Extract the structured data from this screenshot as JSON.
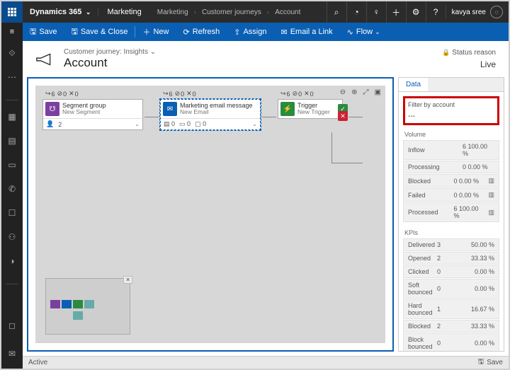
{
  "topbar": {
    "brand": "Dynamics 365",
    "module": "Marketing",
    "breadcrumbs": [
      "Marketing",
      "Customer journeys",
      "Account"
    ],
    "user": "kavya sree"
  },
  "commands": {
    "save": "Save",
    "save_close": "Save & Close",
    "new": "New",
    "refresh": "Refresh",
    "assign": "Assign",
    "email": "Email a Link",
    "flow": "Flow"
  },
  "header": {
    "sub": "Customer journey: Insights",
    "title": "Account",
    "status_label": "Status reason",
    "status_value": "Live"
  },
  "tiles": [
    {
      "stat_a": "6",
      "stat_b": "0",
      "stat_c": "0",
      "title": "Segment group",
      "sub": "New Segment",
      "bot": "2"
    },
    {
      "stat_a": "6",
      "stat_b": "0",
      "stat_c": "0",
      "title": "Marketing email message",
      "sub": "New Email",
      "b1": "0",
      "b2": "0",
      "b3": "0"
    },
    {
      "stat_a": "6",
      "stat_b": "0",
      "stat_c": "0",
      "title": "Trigger",
      "sub": "New Trigger"
    }
  ],
  "side": {
    "tab": "Data",
    "filter_label": "Filter by account",
    "filter_value": "---",
    "volume_h": "Volume",
    "kpi_h": "KPIs",
    "volume": [
      {
        "k": "Inflow",
        "v": "6",
        "p": "100.00 %"
      },
      {
        "k": "Processing",
        "v": "0",
        "p": "0.00 %"
      },
      {
        "k": "Blocked",
        "v": "0",
        "p": "0.00 %"
      },
      {
        "k": "Failed",
        "v": "0",
        "p": "0.00 %"
      },
      {
        "k": "Processed",
        "v": "6",
        "p": "100.00 %"
      }
    ],
    "kpis": [
      {
        "k": "Delivered",
        "v": "3",
        "p": "50.00 %"
      },
      {
        "k": "Opened",
        "v": "2",
        "p": "33.33 %"
      },
      {
        "k": "Clicked",
        "v": "0",
        "p": "0.00 %"
      },
      {
        "k": "Soft bounced",
        "v": "0",
        "p": "0.00 %"
      },
      {
        "k": "Hard bounced",
        "v": "1",
        "p": "16.67 %"
      },
      {
        "k": "Blocked",
        "v": "2",
        "p": "33.33 %"
      },
      {
        "k": "Block bounced",
        "v": "0",
        "p": "0.00 %"
      }
    ]
  },
  "footer": {
    "state": "Active",
    "save": "Save"
  }
}
